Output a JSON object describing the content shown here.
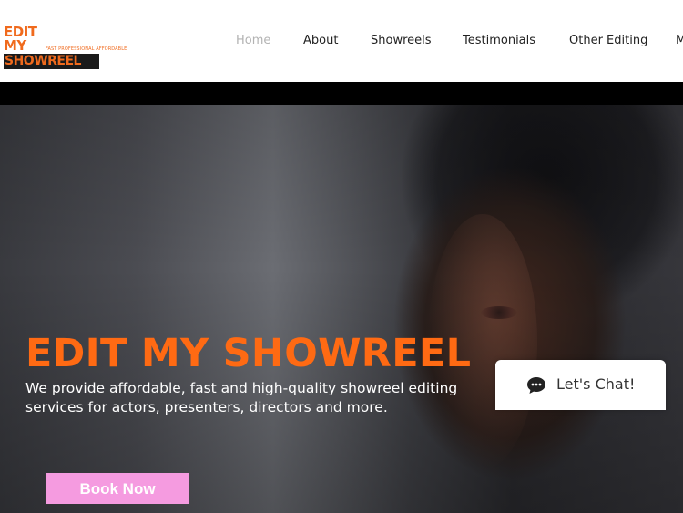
{
  "logo": {
    "line1": "EDIT",
    "line2": "MY",
    "tagline": "FAST PROFESSIONAL AFFORDABLE",
    "line3": "SHOWREEL"
  },
  "nav": {
    "items": [
      {
        "label": "Home",
        "active": true
      },
      {
        "label": "About"
      },
      {
        "label": "Showreels"
      },
      {
        "label": "Testimonials"
      },
      {
        "label": "Other Editing"
      },
      {
        "label": "M"
      }
    ]
  },
  "hero": {
    "title": "EDIT MY SHOWREEL",
    "subtitle": "We provide affordable, fast and high-quality showreel editing services for actors, presenters, directors and more.",
    "cta_label": "Book Now"
  },
  "chat": {
    "label": "Let's Chat!"
  },
  "colors": {
    "accent": "#ff6a13",
    "button": "#f59be0"
  }
}
